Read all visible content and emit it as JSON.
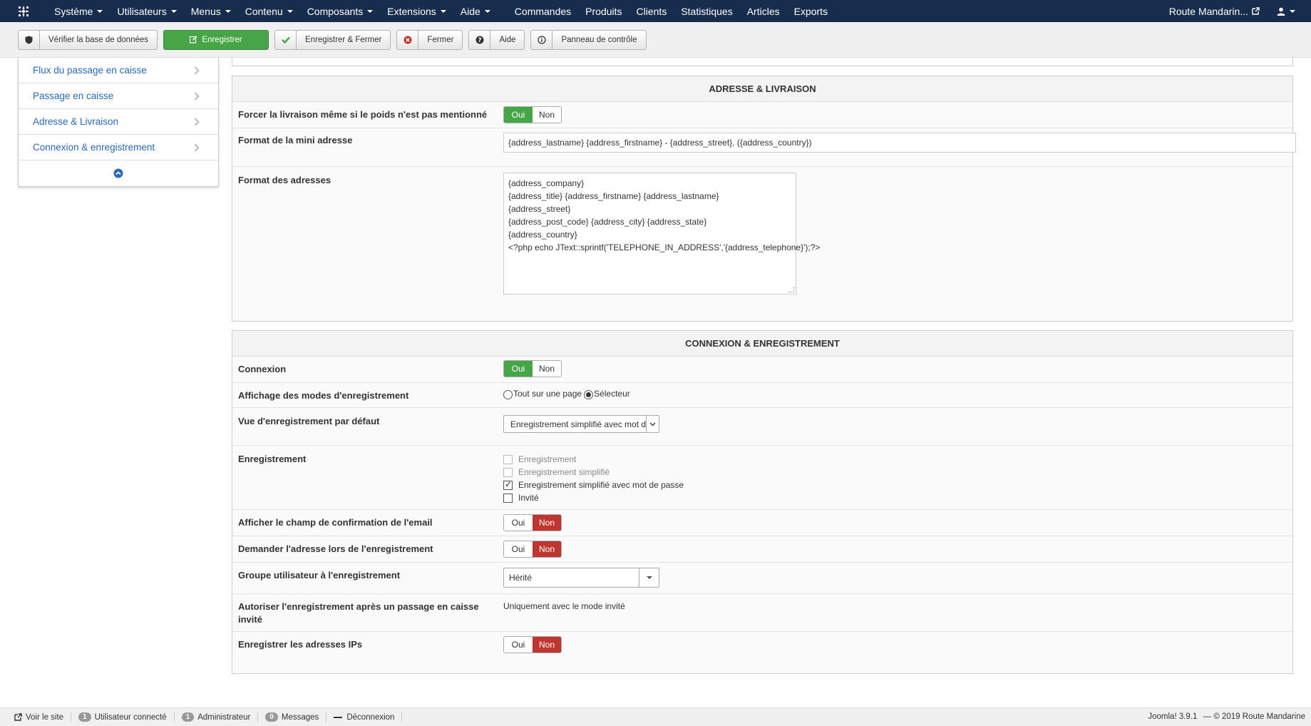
{
  "navbar": {
    "logo_icon": "joomla-logo-icon",
    "menus": [
      {
        "label": "Système",
        "dropdown": true
      },
      {
        "label": "Utilisateurs",
        "dropdown": true
      },
      {
        "label": "Menus",
        "dropdown": true
      },
      {
        "label": "Contenu",
        "dropdown": true
      },
      {
        "label": "Composants",
        "dropdown": true
      },
      {
        "label": "Extensions",
        "dropdown": true
      },
      {
        "label": "Aide",
        "dropdown": true
      }
    ],
    "links": [
      "Commandes",
      "Produits",
      "Clients",
      "Statistiques",
      "Articles",
      "Exports"
    ],
    "site_name": "Route Mandarin...",
    "user_icon": "user-icon"
  },
  "toolbar": {
    "check_db": "Vérifier la base de données",
    "save": "Enregistrer",
    "save_close": "Enregistrer & Fermer",
    "close": "Fermer",
    "help": "Aide",
    "control_panel": "Panneau de contrôle"
  },
  "sidebar": {
    "items": [
      "Flux du passage en caisse",
      "Passage en caisse",
      "Adresse & Livraison",
      "Connexion & enregistrement"
    ]
  },
  "address_panel": {
    "title": "ADRESSE & LIVRAISON",
    "force_shipping_label": "Forcer la livraison même si le poids n'est pas mentionné",
    "mini_address_label": "Format de la mini adresse",
    "mini_address_value": "{address_lastname} {address_firstname} - {address_street}, ({address_country})",
    "address_format_label": "Format des adresses",
    "address_format_lines": [
      "{address_company}",
      "{address_title} {address_firstname} {address_lastname}",
      "{address_street}",
      "{address_post_code} {address_city} {address_state}",
      "{address_country}",
      "<?php echo JText::sprintf('TELEPHONE_IN_ADDRESS','{address_telephone}');?>"
    ]
  },
  "login_panel": {
    "title": "CONNEXION & ENREGISTREMENT",
    "login_label": "Connexion",
    "display_modes_label": "Affichage des modes d'enregistrement",
    "mode_one_page": "Tout sur une page",
    "mode_selector": "Sélecteur",
    "default_view_label": "Vue d'enregistrement par défaut",
    "default_view_value": "Enregistrement simplifié avec mot de passe",
    "registration_label": "Enregistrement",
    "registration_options": [
      {
        "label": "Enregistrement",
        "checked": false,
        "disabled": true
      },
      {
        "label": "Enregistrement simplifié",
        "checked": false,
        "disabled": true
      },
      {
        "label": "Enregistrement simplifié avec mot de passe",
        "checked": true,
        "disabled": false
      },
      {
        "label": "Invité",
        "checked": false,
        "disabled": false
      }
    ],
    "email_confirm_label": "Afficher le champ de confirmation de l'email",
    "ask_address_label": "Demander l'adresse lors de l'enregistrement",
    "user_group_label": "Groupe utilisateur à l'enregistrement",
    "user_group_value": "Hérité",
    "allow_after_guest_label": "Autoriser l'enregistrement après un passage en caisse invité",
    "allow_after_guest_value": "Uniquement avec le mode invité",
    "save_ips_label": "Enregistrer les adresses IPs"
  },
  "toggle": {
    "yes": "Oui",
    "no": "Non"
  },
  "footer": {
    "view_site": "Voir le site",
    "connected_count": "1",
    "connected_label": "Utilisateur connecté",
    "admin_count": "1",
    "admin_label": "Administrateur",
    "messages_count": "0",
    "messages_label": "Messages",
    "logout": "Déconnexion",
    "version": "Joomla! 3.9.1",
    "copyright": "— © 2019 Route Mandarine"
  },
  "colors": {
    "navbar": "#182c4d",
    "green": "#46a546",
    "red": "#bd362f",
    "link": "#2a69b8"
  }
}
